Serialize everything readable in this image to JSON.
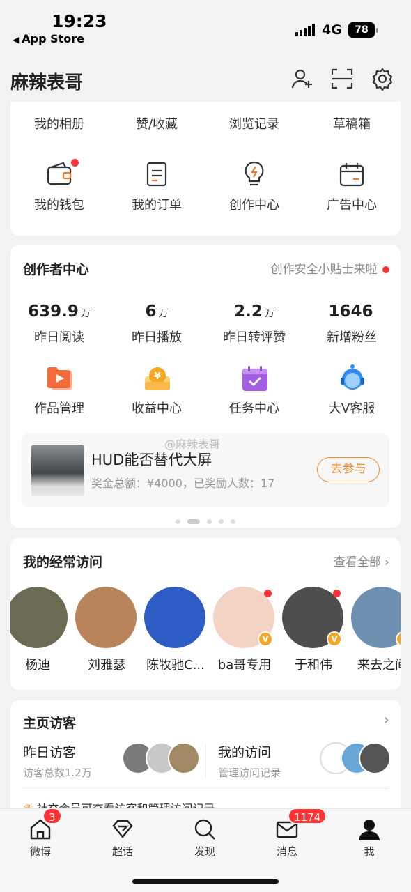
{
  "status_bar": {
    "time": "19:23",
    "back_app": "App Store",
    "network": "4G",
    "battery": "78"
  },
  "nav": {
    "title": "麻辣表哥",
    "icons": [
      "add-user-icon",
      "scan-icon",
      "settings-icon"
    ]
  },
  "quick_links": {
    "row1": [
      "我的相册",
      "赞/收藏",
      "浏览记录",
      "草稿箱"
    ],
    "row2": [
      {
        "label": "我的钱包",
        "icon": "wallet-icon",
        "dot": true
      },
      {
        "label": "我的订单",
        "icon": "order-icon",
        "dot": false
      },
      {
        "label": "创作中心",
        "icon": "bulb-icon",
        "dot": false
      },
      {
        "label": "广告中心",
        "icon": "ad-calendar-icon",
        "dot": false
      }
    ]
  },
  "creator_center": {
    "title": "创作者中心",
    "tip": "创作安全小贴士来啦",
    "stats": [
      {
        "value": "639.9",
        "unit": "万",
        "label": "昨日阅读"
      },
      {
        "value": "6",
        "unit": "万",
        "label": "昨日播放"
      },
      {
        "value": "2.2",
        "unit": "万",
        "label": "昨日转评赞"
      },
      {
        "value": "1646",
        "unit": "",
        "label": "新增粉丝"
      }
    ],
    "tools": [
      {
        "label": "作品管理",
        "icon": "works-icon",
        "color": "#f26b3a"
      },
      {
        "label": "收益中心",
        "icon": "income-icon",
        "color": "#f5a623"
      },
      {
        "label": "任务中心",
        "icon": "task-calendar-icon",
        "color": "#a45ee5"
      },
      {
        "label": "大V客服",
        "icon": "service-headset-icon",
        "color": "#2f8cf2"
      }
    ],
    "banner": {
      "title": "HUD能否替代大屏",
      "subtitle": "奖金总额：¥4000，已奖励人数：17",
      "button": "去参与"
    },
    "watermark": "@麻辣表哥"
  },
  "frequent_visits": {
    "title": "我的经常访问",
    "view_all": "查看全部",
    "people": [
      {
        "name": "杨迪",
        "color": "#6b6a52",
        "badge": false,
        "dot": false
      },
      {
        "name": "刘雅瑟",
        "color": "#b9845c",
        "badge": false,
        "dot": false
      },
      {
        "name": "陈牧驰C...",
        "color": "#2c5cc4",
        "badge": false,
        "dot": false
      },
      {
        "name": "ba哥专用",
        "color": "#f3d3c4",
        "badge": true,
        "dot": true
      },
      {
        "name": "于和伟",
        "color": "#4e4e4e",
        "badge": true,
        "dot": true
      },
      {
        "name": "来去之间",
        "color": "#6d8fb0",
        "badge": true,
        "dot": false
      }
    ]
  },
  "visitors": {
    "title": "主页访客",
    "left_title": "昨日访客",
    "left_sub": "访客总数1.2万",
    "right_title": "我的访问",
    "right_sub": "管理访问记录",
    "footer": "社交会员可查看访客和管理访问记录"
  },
  "tabbar": [
    {
      "label": "微博",
      "icon": "home-icon",
      "badge": "3"
    },
    {
      "label": "超话",
      "icon": "diamond-icon",
      "badge": ""
    },
    {
      "label": "发现",
      "icon": "search-icon",
      "badge": ""
    },
    {
      "label": "消息",
      "icon": "mail-icon",
      "badge": "1174"
    },
    {
      "label": "我",
      "icon": "profile-icon",
      "badge": ""
    }
  ]
}
